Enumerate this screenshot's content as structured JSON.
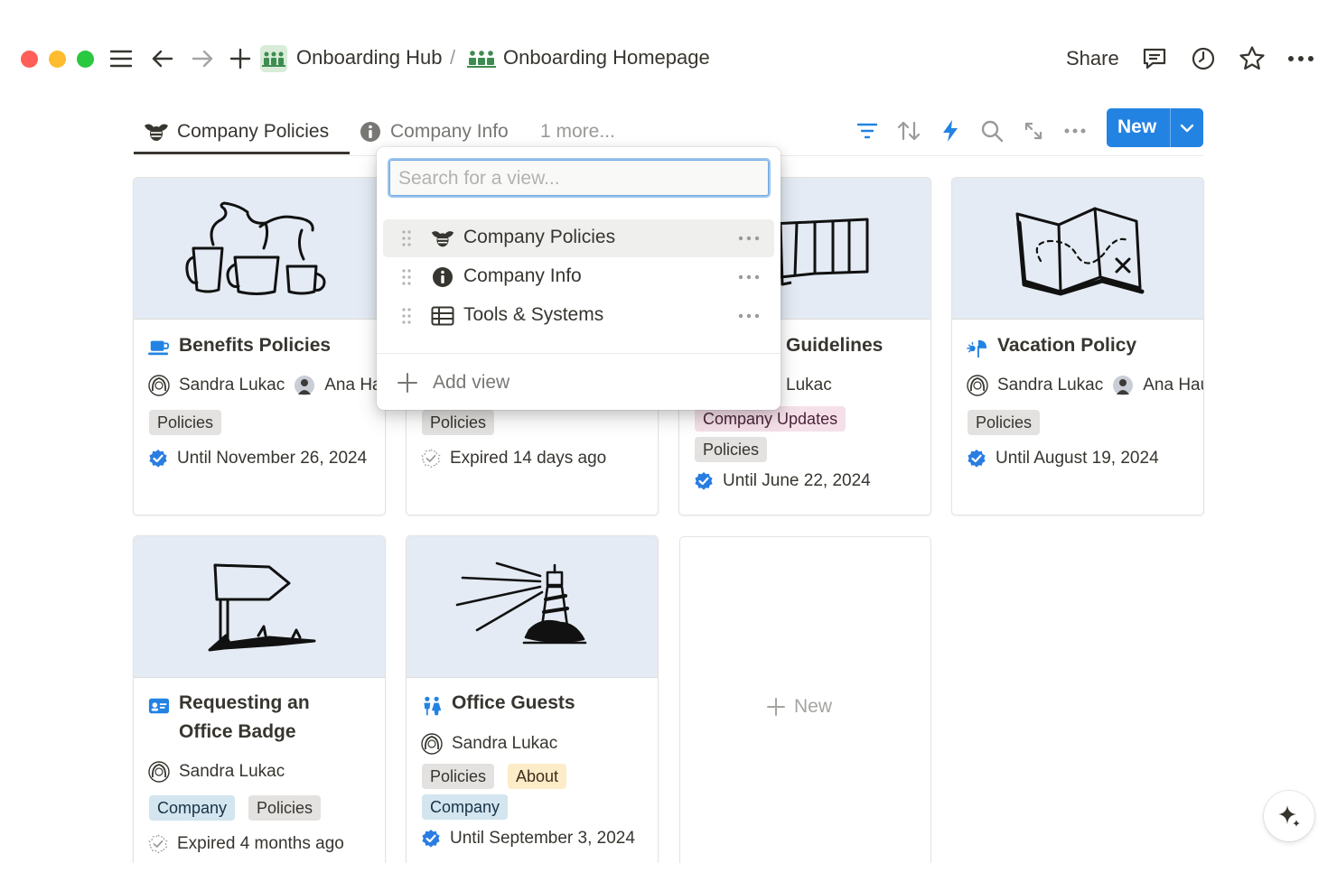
{
  "window": {
    "breadcrumb": [
      {
        "label": "Onboarding Hub",
        "icon": "people-group-icon"
      },
      {
        "label": "Onboarding Homepage",
        "icon": "people-group-icon"
      }
    ],
    "separator": "/",
    "share_label": "Share"
  },
  "views": {
    "tabs": [
      {
        "label": "Company Policies",
        "icon": "bee-icon",
        "active": true
      },
      {
        "label": "Company Info",
        "icon": "info-icon",
        "active": false
      }
    ],
    "more_label": "1 more...",
    "new_button_label": "New"
  },
  "dropdown": {
    "search_placeholder": "Search for a view...",
    "items": [
      {
        "label": "Company Policies",
        "icon": "bee-icon"
      },
      {
        "label": "Company Info",
        "icon": "info-icon"
      },
      {
        "label": "Tools & Systems",
        "icon": "table-icon"
      }
    ],
    "add_view_label": "Add view"
  },
  "cards": [
    {
      "title": "Benefits Policies",
      "icon": "coffee-cup-icon",
      "people": [
        "Sandra Lukac",
        "Ana Ha"
      ],
      "tags": [
        "Policies"
      ],
      "status": "Until November 26, 2024",
      "verified": true
    },
    {
      "title": "",
      "tags": [
        "Policies"
      ],
      "status": "Expired 14 days ago",
      "verified": false
    },
    {
      "title": "Guidelines",
      "people": [
        "Lukac"
      ],
      "tags": [
        "Company Updates",
        "Policies"
      ],
      "status": "Until June 22, 2024",
      "verified": true
    },
    {
      "title": "Vacation Policy",
      "icon": "sun-umbrella-icon",
      "people": [
        "Sandra Lukac",
        "Ana Hau"
      ],
      "tags": [
        "Policies"
      ],
      "status": "Until August 19, 2024",
      "verified": true
    },
    {
      "title_line1": "Requesting an",
      "title_line2": "Office Badge",
      "icon": "id-badge-icon",
      "people": [
        "Sandra Lukac"
      ],
      "tags": [
        "Company",
        "Policies"
      ],
      "status": "Expired 4 months ago",
      "verified": false
    },
    {
      "title": "Office Guests",
      "icon": "people-icon",
      "people": [
        "Sandra Lukac"
      ],
      "tags": [
        "Policies",
        "About",
        "Company"
      ],
      "status": "Until September 3, 2024",
      "verified": true
    }
  ],
  "empty_new_label": "New",
  "colors": {
    "accent": "#2383e2",
    "cover": "#e4ebf4",
    "verified": "#2a7de1"
  }
}
